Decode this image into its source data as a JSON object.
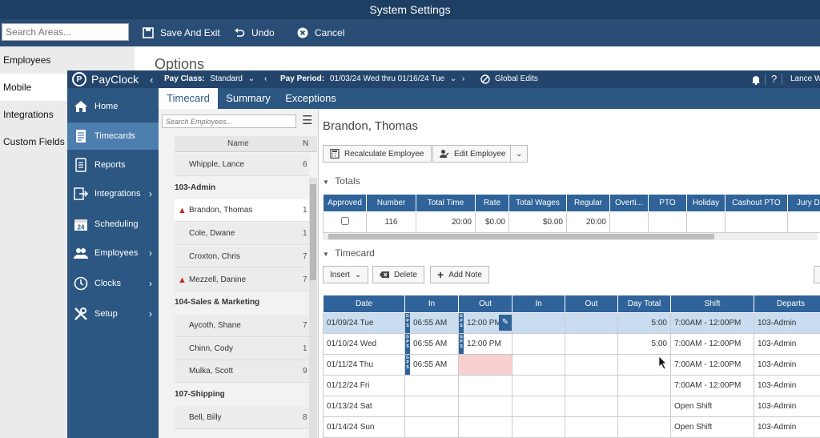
{
  "window": {
    "title": "System Settings"
  },
  "toolbar": {
    "search_placeholder": "Search Areas...",
    "save_exit": "Save And Exit",
    "undo": "Undo",
    "cancel": "Cancel"
  },
  "left_menu": [
    "Employees",
    "Mobile",
    "Integrations",
    "Custom Fields"
  ],
  "options_heading": "Options",
  "payclock": {
    "brand": "PayClock",
    "pay_class_label": "Pay Class:",
    "pay_class_value": "Standard",
    "pay_period_label": "Pay Period:",
    "pay_period_value": "01/03/24 Wed thru 01/16/24 Tue",
    "global_edits": "Global Edits",
    "user": "Lance W",
    "nav": [
      {
        "label": "Home",
        "icon": "home-icon"
      },
      {
        "label": "Timecards",
        "icon": "timecard-icon"
      },
      {
        "label": "Reports",
        "icon": "report-icon"
      },
      {
        "label": "Integrations",
        "icon": "integrations-icon"
      },
      {
        "label": "Scheduling",
        "icon": "calendar-icon"
      },
      {
        "label": "Employees",
        "icon": "people-icon"
      },
      {
        "label": "Clocks",
        "icon": "clock-icon"
      },
      {
        "label": "Setup",
        "icon": "tools-icon"
      }
    ],
    "tabs": [
      "Timecard",
      "Summary",
      "Exceptions"
    ],
    "employee_search_placeholder": "Search Employees...",
    "employee_col_name": "Name",
    "employee_col_num": "N",
    "employees": [
      {
        "type": "row",
        "name": "Whipple, Lance",
        "num": "6"
      },
      {
        "type": "group",
        "name": "103-Admin"
      },
      {
        "type": "row",
        "name": "Brandon, Thomas",
        "num": "1",
        "warn": true,
        "selected": true
      },
      {
        "type": "row",
        "name": "Cole, Dwane",
        "num": "1"
      },
      {
        "type": "row",
        "name": "Croxton, Chris",
        "num": "7"
      },
      {
        "type": "row",
        "name": "Mezzell, Danine",
        "num": "7",
        "warn": true
      },
      {
        "type": "group",
        "name": "104-Sales & Marketing"
      },
      {
        "type": "row",
        "name": "Aycoth, Shane",
        "num": "7"
      },
      {
        "type": "row",
        "name": "Chinn, Cody",
        "num": "1"
      },
      {
        "type": "row",
        "name": "Mulka, Scott",
        "num": "9"
      },
      {
        "type": "group",
        "name": "107-Shipping"
      },
      {
        "type": "row",
        "name": "Bell, Billy",
        "num": "8"
      }
    ],
    "selected_employee": "Brandon, Thomas",
    "recalculate": "Recalculate Employee",
    "edit_employee": "Edit Employee",
    "totals_label": "Totals",
    "totals_headers": [
      "Approved",
      "Number",
      "Total Time",
      "Rate",
      "Total Wages",
      "Regular",
      "Overti...",
      "PTO",
      "Holiday",
      "Cashout PTO",
      "Jury D..."
    ],
    "totals_row": [
      "",
      "116",
      "20:00",
      "$0.00",
      "$0.00",
      "20:00",
      "",
      "",
      "",
      "",
      ""
    ],
    "timecard_label": "Timecard",
    "insert": "Insert",
    "delete": "Delete",
    "add_note": "Add Note",
    "tc_headers": [
      "Date",
      "In",
      "Out",
      "In",
      "Out",
      "Day Total",
      "Shift",
      "Departs"
    ],
    "gps_label": "GPS",
    "tc_rows": [
      {
        "date": "01/09/24 Tue",
        "in1": "06:55 AM",
        "out1": "12:00 PM",
        "total": "5:00",
        "shift": "7:00AM - 12:00PM",
        "dept": "103-Admin",
        "highlight": true,
        "gps_in": true,
        "gps_out": true
      },
      {
        "date": "01/10/24 Wed",
        "in1": "06:55 AM",
        "out1": "12:00 PM",
        "total": "5:00",
        "shift": "7:00AM - 12:00PM",
        "dept": "103-Admin",
        "gps_in": true,
        "gps_out": true
      },
      {
        "date": "01/11/24 Thu",
        "in1": "06:55 AM",
        "out1": "",
        "total": "",
        "shift": "7:00AM - 12:00PM",
        "dept": "103-Admin",
        "gps_in": true,
        "missing_out": true
      },
      {
        "date": "01/12/24 Fri",
        "in1": "",
        "out1": "",
        "total": "",
        "shift": "7:00AM - 12:00PM",
        "dept": "103-Admin"
      },
      {
        "date": "01/13/24 Sat",
        "in1": "",
        "out1": "",
        "total": "",
        "shift": "Open Shift",
        "dept": "103-Admin"
      },
      {
        "date": "01/14/24 Sun",
        "in1": "",
        "out1": "",
        "total": "",
        "shift": "Open Shift",
        "dept": "103-Admin"
      }
    ],
    "colors": {
      "header": "#23456c",
      "sidebar": "#2b5782",
      "table_header": "#2f6399",
      "highlight": "#c9dcf0",
      "error": "#f8d0d0",
      "warning": "#c62828"
    }
  }
}
